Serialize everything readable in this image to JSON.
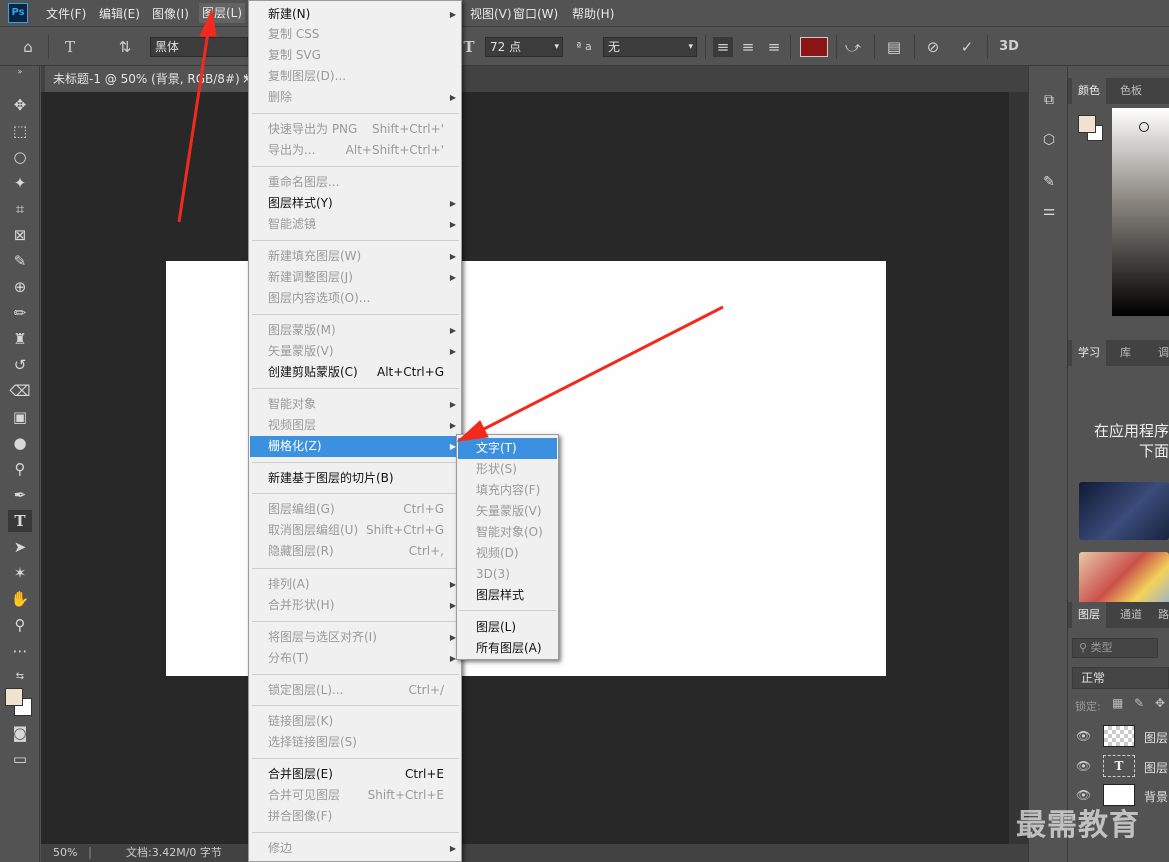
{
  "app_logo": "Ps",
  "menubar": {
    "items": [
      "文件(F)",
      "编辑(E)",
      "图像(I)",
      "图层(L)",
      "视图(V)",
      "窗口(W)",
      "帮助(H)"
    ]
  },
  "options": {
    "font_family": "黑体",
    "font_size": "72 点",
    "antialias_label": "ª a",
    "antialias_value": "无",
    "text_color": "#8b1414",
    "threed": "3D"
  },
  "document": {
    "tab_title": "未标题-1 @ 50% (背景, RGB/8#) *",
    "tab_close": "×",
    "zoom": "50%",
    "doc_info": "文档:3.42M/0 字节"
  },
  "layer_menu": {
    "items": [
      {
        "label": "新建(N)",
        "shortcut": "",
        "submenu": true,
        "enabled": true
      },
      {
        "label": "复制 CSS",
        "shortcut": "",
        "submenu": false,
        "enabled": false
      },
      {
        "label": "复制 SVG",
        "shortcut": "",
        "submenu": false,
        "enabled": false
      },
      {
        "label": "复制图层(D)...",
        "shortcut": "",
        "submenu": false,
        "enabled": false
      },
      {
        "label": "删除",
        "shortcut": "",
        "submenu": true,
        "enabled": false
      },
      {
        "label": "快速导出为 PNG",
        "shortcut": "Shift+Ctrl+'",
        "submenu": false,
        "enabled": false
      },
      {
        "label": "导出为...",
        "shortcut": "Alt+Shift+Ctrl+'",
        "submenu": false,
        "enabled": false
      },
      {
        "label": "重命名图层...",
        "shortcut": "",
        "submenu": false,
        "enabled": false
      },
      {
        "label": "图层样式(Y)",
        "shortcut": "",
        "submenu": true,
        "enabled": true
      },
      {
        "label": "智能滤镜",
        "shortcut": "",
        "submenu": true,
        "enabled": false
      },
      {
        "label": "新建填充图层(W)",
        "shortcut": "",
        "submenu": true,
        "enabled": false
      },
      {
        "label": "新建调整图层(J)",
        "shortcut": "",
        "submenu": true,
        "enabled": false
      },
      {
        "label": "图层内容选项(O)...",
        "shortcut": "",
        "submenu": false,
        "enabled": false
      },
      {
        "label": "图层蒙版(M)",
        "shortcut": "",
        "submenu": true,
        "enabled": false
      },
      {
        "label": "矢量蒙版(V)",
        "shortcut": "",
        "submenu": true,
        "enabled": false
      },
      {
        "label": "创建剪贴蒙版(C)",
        "shortcut": "Alt+Ctrl+G",
        "submenu": false,
        "enabled": true
      },
      {
        "label": "智能对象",
        "shortcut": "",
        "submenu": true,
        "enabled": false
      },
      {
        "label": "视频图层",
        "shortcut": "",
        "submenu": true,
        "enabled": false
      },
      {
        "label": "栅格化(Z)",
        "shortcut": "",
        "submenu": true,
        "enabled": true
      },
      {
        "label": "新建基于图层的切片(B)",
        "shortcut": "",
        "submenu": false,
        "enabled": true
      },
      {
        "label": "图层编组(G)",
        "shortcut": "Ctrl+G",
        "submenu": false,
        "enabled": false
      },
      {
        "label": "取消图层编组(U)",
        "shortcut": "Shift+Ctrl+G",
        "submenu": false,
        "enabled": false
      },
      {
        "label": "隐藏图层(R)",
        "shortcut": "Ctrl+,",
        "submenu": false,
        "enabled": false
      },
      {
        "label": "排列(A)",
        "shortcut": "",
        "submenu": true,
        "enabled": false
      },
      {
        "label": "合并形状(H)",
        "shortcut": "",
        "submenu": true,
        "enabled": false
      },
      {
        "label": "将图层与选区对齐(I)",
        "shortcut": "",
        "submenu": true,
        "enabled": false
      },
      {
        "label": "分布(T)",
        "shortcut": "",
        "submenu": true,
        "enabled": false
      },
      {
        "label": "锁定图层(L)...",
        "shortcut": "Ctrl+/",
        "submenu": false,
        "enabled": false
      },
      {
        "label": "链接图层(K)",
        "shortcut": "",
        "submenu": false,
        "enabled": false
      },
      {
        "label": "选择链接图层(S)",
        "shortcut": "",
        "submenu": false,
        "enabled": false
      },
      {
        "label": "合并图层(E)",
        "shortcut": "Ctrl+E",
        "submenu": false,
        "enabled": true
      },
      {
        "label": "合并可见图层",
        "shortcut": "Shift+Ctrl+E",
        "submenu": false,
        "enabled": false
      },
      {
        "label": "拼合图像(F)",
        "shortcut": "",
        "submenu": false,
        "enabled": false
      },
      {
        "label": "修边",
        "shortcut": "",
        "submenu": true,
        "enabled": false
      }
    ]
  },
  "rasterize_submenu": {
    "items": [
      {
        "label": "文字(T)",
        "enabled": true
      },
      {
        "label": "形状(S)",
        "enabled": false
      },
      {
        "label": "填充内容(F)",
        "enabled": false
      },
      {
        "label": "矢量蒙版(V)",
        "enabled": false
      },
      {
        "label": "智能对象(O)",
        "enabled": false
      },
      {
        "label": "视频(D)",
        "enabled": false
      },
      {
        "label": "3D(3)",
        "enabled": false
      },
      {
        "label": "图层样式",
        "enabled": true
      },
      {
        "label": "图层(L)",
        "enabled": true
      },
      {
        "label": "所有图层(A)",
        "enabled": true
      }
    ]
  },
  "right_panel": {
    "color_tabs": [
      "颜色",
      "色板"
    ],
    "learn_tabs": [
      "学习",
      "库",
      "调"
    ],
    "learn_text_1": "在应用程序",
    "learn_text_2": "下面",
    "layer_tabs": [
      "图层",
      "通道",
      "路"
    ],
    "filter_placeholder": "类型",
    "blend_mode": "正常",
    "lock_label": "锁定:",
    "layers": [
      "图层",
      "图层",
      "背景"
    ]
  },
  "watermark": "最需教育",
  "colors": {
    "highlight": "#3c90e0",
    "arrow": "#f22a1e",
    "foreground_swatch": "#efe3cf"
  }
}
